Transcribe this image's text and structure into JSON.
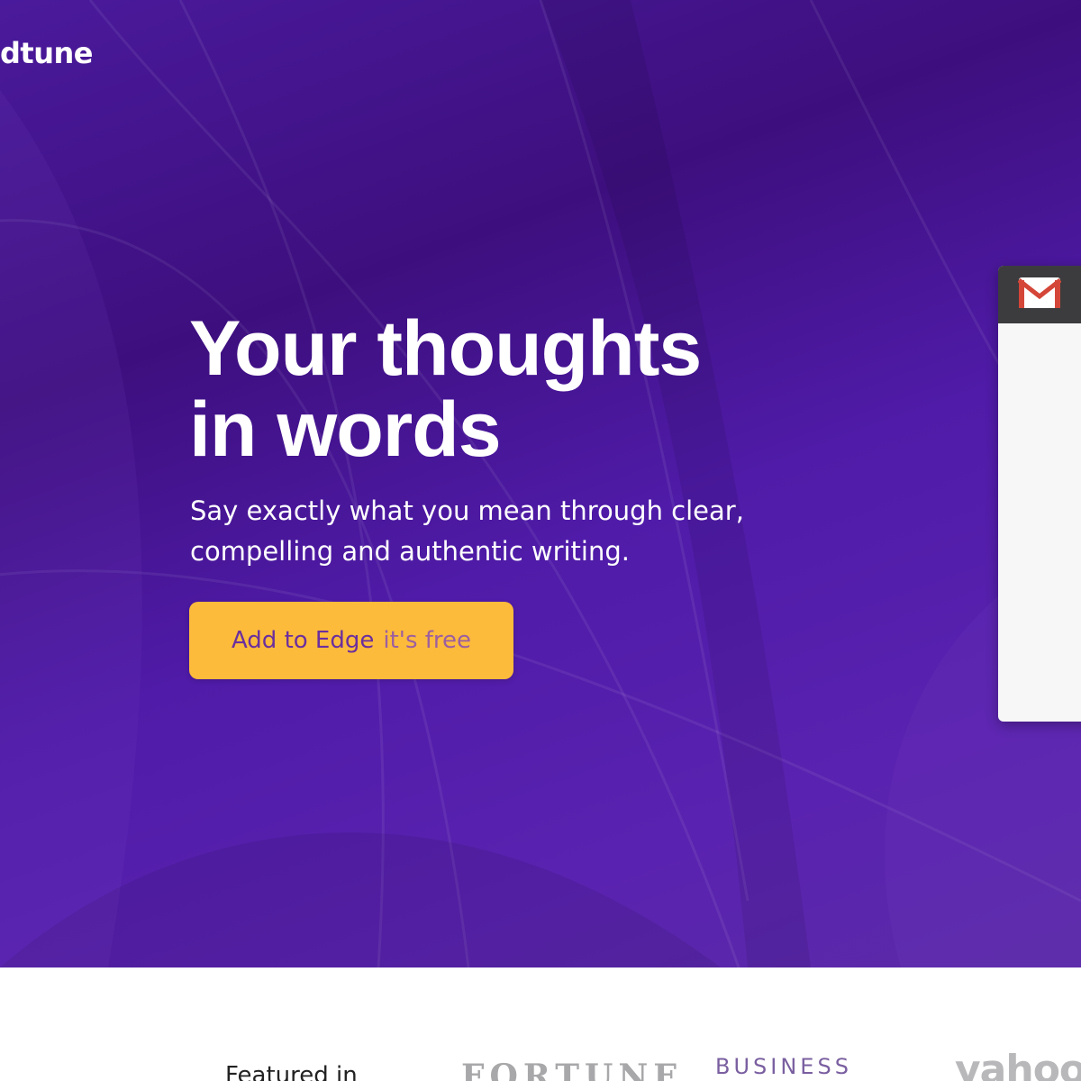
{
  "header": {
    "logo_text": "dtune"
  },
  "hero": {
    "headline_line1": "Your thoughts",
    "headline_line2": "in words",
    "subtext_line1": "Say exactly what you mean through clear,",
    "subtext_line2": "compelling and authentic writing.",
    "cta_main": "Add to Edge",
    "cta_sub": "it's free"
  },
  "side_panel": {
    "icon": "gmail-icon"
  },
  "featured": {
    "label": "Featured in",
    "logos": [
      "FORTUNE",
      "BUSINESS",
      "yahoo"
    ]
  },
  "colors": {
    "hero_bg": "#4a1a9c",
    "cta_bg": "#fdbb3b",
    "cta_text": "#6b2f9e"
  }
}
